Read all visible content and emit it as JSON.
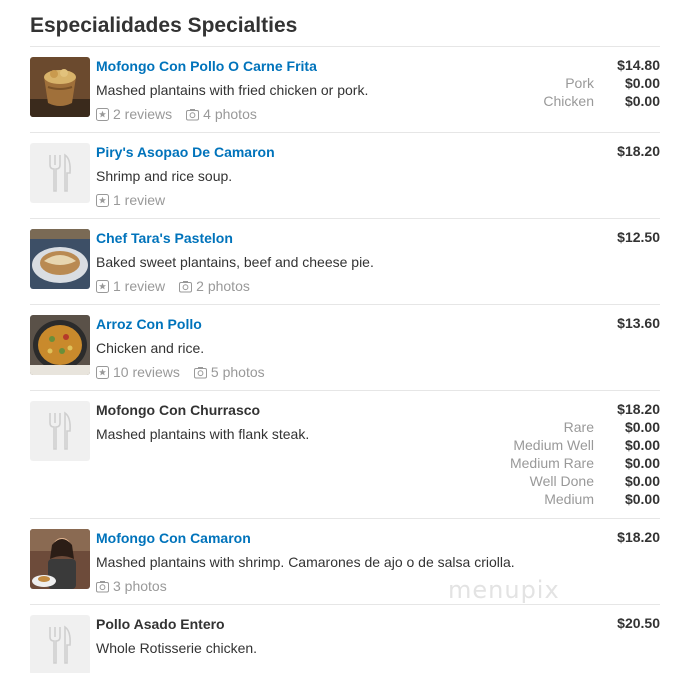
{
  "section": {
    "title": "Especialidades Specialties"
  },
  "watermark": "menupix",
  "items": [
    {
      "name": "Mofongo Con Pollo O Carne Frita",
      "description": "Mashed plantains with fried chicken or pork.",
      "reviews": "2 reviews",
      "photos": "4 photos",
      "base_price": "$14.80",
      "options": [
        {
          "label": "Pork",
          "price": "$0.00"
        },
        {
          "label": "Chicken",
          "price": "$0.00"
        }
      ]
    },
    {
      "name": "Piry's Asopao De Camaron",
      "description": "Shrimp and rice soup.",
      "reviews": "1 review",
      "base_price": "$18.20"
    },
    {
      "name": "Chef Tara's Pastelon",
      "description": "Baked sweet plantains, beef and cheese pie.",
      "reviews": "1 review",
      "photos": "2 photos",
      "base_price": "$12.50"
    },
    {
      "name": "Arroz Con Pollo",
      "description": "Chicken and rice.",
      "reviews": "10 reviews",
      "photos": "5 photos",
      "base_price": "$13.60"
    },
    {
      "name": "Mofongo Con Churrasco",
      "description": "Mashed plantains with flank steak.",
      "base_price": "$18.20",
      "options": [
        {
          "label": "Rare",
          "price": "$0.00"
        },
        {
          "label": "Medium Well",
          "price": "$0.00"
        },
        {
          "label": "Medium Rare",
          "price": "$0.00"
        },
        {
          "label": "Well Done",
          "price": "$0.00"
        },
        {
          "label": "Medium",
          "price": "$0.00"
        }
      ]
    },
    {
      "name": "Mofongo Con Camaron",
      "description": "Mashed plantains with shrimp. Camarones de ajo o de salsa criolla.",
      "photos": "3 photos",
      "base_price": "$18.20"
    },
    {
      "name": "Pollo Asado Entero",
      "description": "Whole Rotisserie chicken.",
      "base_price": "$20.50"
    }
  ]
}
